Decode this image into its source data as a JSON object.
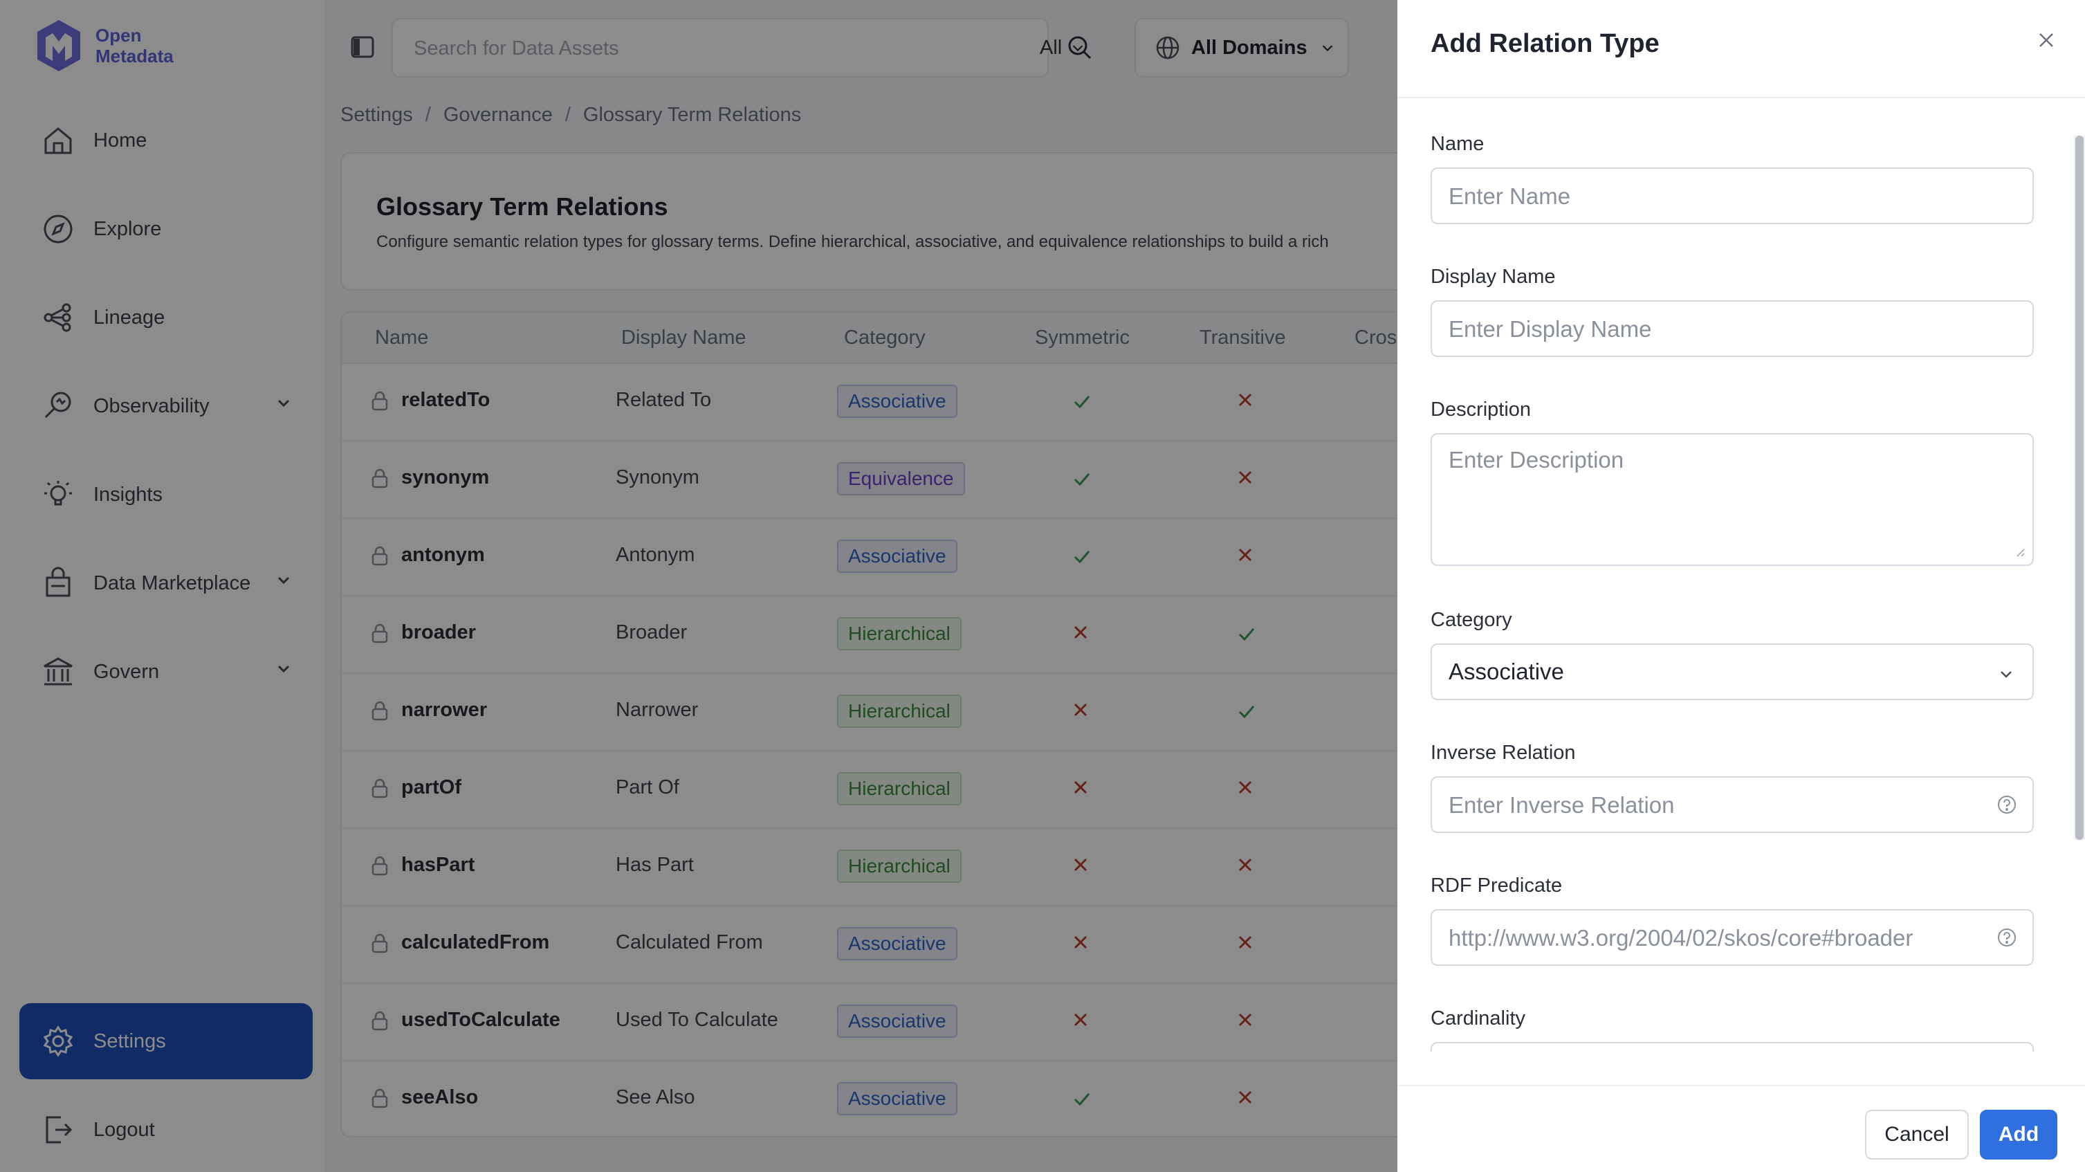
{
  "app": {
    "logo_text": "Open\nMetadata",
    "logo_line1": "Open",
    "logo_line2": "Metadata"
  },
  "sidebar": {
    "items": [
      {
        "label": "Home",
        "icon": "home-icon"
      },
      {
        "label": "Explore",
        "icon": "compass-icon"
      },
      {
        "label": "Lineage",
        "icon": "lineage-icon"
      },
      {
        "label": "Observability",
        "icon": "observability-icon",
        "has_chevron": true
      },
      {
        "label": "Insights",
        "icon": "lightbulb-icon"
      },
      {
        "label": "Data Marketplace",
        "icon": "marketplace-icon",
        "has_chevron": true
      },
      {
        "label": "Govern",
        "icon": "bank-icon",
        "has_chevron": true
      },
      {
        "label": "Settings",
        "icon": "gear-icon",
        "active": true
      },
      {
        "label": "Logout",
        "icon": "logout-icon"
      }
    ]
  },
  "search": {
    "placeholder": "Search for Data Assets",
    "scope": "All"
  },
  "domain_selector": {
    "label": "All Domains"
  },
  "breadcrumb": [
    "Settings",
    "Governance",
    "Glossary Term Relations"
  ],
  "page": {
    "title": "Glossary Term Relations",
    "description": "Configure semantic relation types for glossary terms. Define hierarchical, associative, and equivalence relationships to build a rich"
  },
  "table": {
    "columns": [
      "Name",
      "Display Name",
      "Category",
      "Symmetric",
      "Transitive",
      "Cros"
    ],
    "rows": [
      {
        "name": "relatedTo",
        "display_name": "Related To",
        "category": "Associative",
        "symmetric": true,
        "transitive": false
      },
      {
        "name": "synonym",
        "display_name": "Synonym",
        "category": "Equivalence",
        "symmetric": true,
        "transitive": false
      },
      {
        "name": "antonym",
        "display_name": "Antonym",
        "category": "Associative",
        "symmetric": true,
        "transitive": false
      },
      {
        "name": "broader",
        "display_name": "Broader",
        "category": "Hierarchical",
        "symmetric": false,
        "transitive": true
      },
      {
        "name": "narrower",
        "display_name": "Narrower",
        "category": "Hierarchical",
        "symmetric": false,
        "transitive": true
      },
      {
        "name": "partOf",
        "display_name": "Part Of",
        "category": "Hierarchical",
        "symmetric": false,
        "transitive": false
      },
      {
        "name": "hasPart",
        "display_name": "Has Part",
        "category": "Hierarchical",
        "symmetric": false,
        "transitive": false
      },
      {
        "name": "calculatedFrom",
        "display_name": "Calculated From",
        "category": "Associative",
        "symmetric": false,
        "transitive": false
      },
      {
        "name": "usedToCalculate",
        "display_name": "Used To Calculate",
        "category": "Associative",
        "symmetric": false,
        "transitive": false
      },
      {
        "name": "seeAlso",
        "display_name": "See Also",
        "category": "Associative",
        "symmetric": true,
        "transitive": false
      }
    ]
  },
  "category_colors": {
    "Associative": {
      "text": "#2f63c9",
      "bg": "#eef3fc",
      "border": "#b9cdf0"
    },
    "Equivalence": {
      "text": "#6a3fc9",
      "bg": "#f3eefc",
      "border": "#d3c3f0"
    },
    "Hierarchical": {
      "text": "#3d8a3d",
      "bg": "#eef7ee",
      "border": "#bfe0bf"
    }
  },
  "colors": {
    "check": "#3f9a5a",
    "cross": "#c0392b",
    "accent": "#2f6fe0",
    "active_nav": "#1e4fb9"
  },
  "drawer": {
    "title": "Add Relation Type",
    "fields": {
      "name": {
        "label": "Name",
        "placeholder": "Enter Name"
      },
      "display_name": {
        "label": "Display Name",
        "placeholder": "Enter Display Name"
      },
      "description": {
        "label": "Description",
        "placeholder": "Enter Description"
      },
      "category": {
        "label": "Category",
        "value": "Associative"
      },
      "inverse_relation": {
        "label": "Inverse Relation",
        "placeholder": "Enter Inverse Relation"
      },
      "rdf_predicate": {
        "label": "RDF Predicate",
        "placeholder": "http://www.w3.org/2004/02/skos/core#broader"
      },
      "cardinality": {
        "label": "Cardinality"
      }
    },
    "cancel_label": "Cancel",
    "add_label": "Add"
  }
}
